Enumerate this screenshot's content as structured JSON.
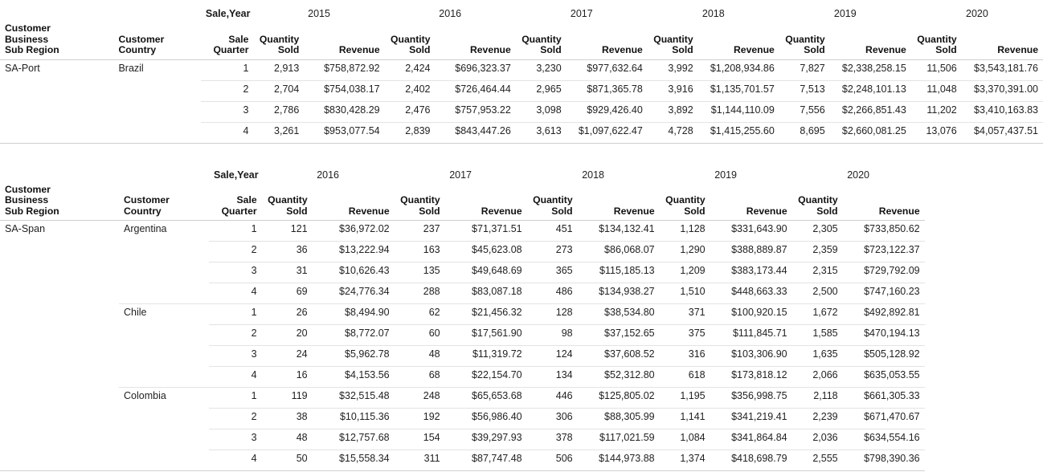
{
  "labels": {
    "sale_year": "Sale,Year",
    "customer_business_sub_region": "Customer\nBusiness\nSub Region",
    "region_line1": "Customer",
    "region_line2": "Business",
    "region_line3": "Sub Region",
    "country_line1": "Customer",
    "country_line2": "Country",
    "quarter_line1": "Sale",
    "quarter_line2": "Quarter",
    "quantity_line1": "Quantity",
    "quantity_line2": "Sold",
    "revenue": "Revenue"
  },
  "tables": [
    {
      "id": "sa-port",
      "years": [
        "2015",
        "2016",
        "2017",
        "2018",
        "2019",
        "2020"
      ],
      "groups": [
        {
          "region": "SA-Port",
          "countries": [
            {
              "country": "Brazil",
              "rows": [
                {
                  "quarter": "1",
                  "cells": [
                    {
                      "qty": "2,913",
                      "rev": "$758,872.92"
                    },
                    {
                      "qty": "2,424",
                      "rev": "$696,323.37"
                    },
                    {
                      "qty": "3,230",
                      "rev": "$977,632.64"
                    },
                    {
                      "qty": "3,992",
                      "rev": "$1,208,934.86"
                    },
                    {
                      "qty": "7,827",
                      "rev": "$2,338,258.15"
                    },
                    {
                      "qty": "11,506",
                      "rev": "$3,543,181.76"
                    }
                  ]
                },
                {
                  "quarter": "2",
                  "cells": [
                    {
                      "qty": "2,704",
                      "rev": "$754,038.17"
                    },
                    {
                      "qty": "2,402",
                      "rev": "$726,464.44"
                    },
                    {
                      "qty": "2,965",
                      "rev": "$871,365.78"
                    },
                    {
                      "qty": "3,916",
                      "rev": "$1,135,701.57"
                    },
                    {
                      "qty": "7,513",
                      "rev": "$2,248,101.13"
                    },
                    {
                      "qty": "11,048",
                      "rev": "$3,370,391.00"
                    }
                  ]
                },
                {
                  "quarter": "3",
                  "cells": [
                    {
                      "qty": "2,786",
                      "rev": "$830,428.29"
                    },
                    {
                      "qty": "2,476",
                      "rev": "$757,953.22"
                    },
                    {
                      "qty": "3,098",
                      "rev": "$929,426.40"
                    },
                    {
                      "qty": "3,892",
                      "rev": "$1,144,110.09"
                    },
                    {
                      "qty": "7,556",
                      "rev": "$2,266,851.43"
                    },
                    {
                      "qty": "11,202",
                      "rev": "$3,410,163.83"
                    }
                  ]
                },
                {
                  "quarter": "4",
                  "cells": [
                    {
                      "qty": "3,261",
                      "rev": "$953,077.54"
                    },
                    {
                      "qty": "2,839",
                      "rev": "$843,447.26"
                    },
                    {
                      "qty": "3,613",
                      "rev": "$1,097,622.47"
                    },
                    {
                      "qty": "4,728",
                      "rev": "$1,415,255.60"
                    },
                    {
                      "qty": "8,695",
                      "rev": "$2,660,081.25"
                    },
                    {
                      "qty": "13,076",
                      "rev": "$4,057,437.51"
                    }
                  ]
                }
              ]
            }
          ]
        }
      ]
    },
    {
      "id": "sa-span",
      "years": [
        "2016",
        "2017",
        "2018",
        "2019",
        "2020"
      ],
      "groups": [
        {
          "region": "SA-Span",
          "countries": [
            {
              "country": "Argentina",
              "rows": [
                {
                  "quarter": "1",
                  "cells": [
                    {
                      "qty": "121",
                      "rev": "$36,972.02"
                    },
                    {
                      "qty": "237",
                      "rev": "$71,371.51"
                    },
                    {
                      "qty": "451",
                      "rev": "$134,132.41"
                    },
                    {
                      "qty": "1,128",
                      "rev": "$331,643.90"
                    },
                    {
                      "qty": "2,305",
                      "rev": "$733,850.62"
                    }
                  ]
                },
                {
                  "quarter": "2",
                  "cells": [
                    {
                      "qty": "36",
                      "rev": "$13,222.94"
                    },
                    {
                      "qty": "163",
                      "rev": "$45,623.08"
                    },
                    {
                      "qty": "273",
                      "rev": "$86,068.07"
                    },
                    {
                      "qty": "1,290",
                      "rev": "$388,889.87"
                    },
                    {
                      "qty": "2,359",
                      "rev": "$723,122.37"
                    }
                  ]
                },
                {
                  "quarter": "3",
                  "cells": [
                    {
                      "qty": "31",
                      "rev": "$10,626.43"
                    },
                    {
                      "qty": "135",
                      "rev": "$49,648.69"
                    },
                    {
                      "qty": "365",
                      "rev": "$115,185.13"
                    },
                    {
                      "qty": "1,209",
                      "rev": "$383,173.44"
                    },
                    {
                      "qty": "2,315",
                      "rev": "$729,792.09"
                    }
                  ]
                },
                {
                  "quarter": "4",
                  "cells": [
                    {
                      "qty": "69",
                      "rev": "$24,776.34"
                    },
                    {
                      "qty": "288",
                      "rev": "$83,087.18"
                    },
                    {
                      "qty": "486",
                      "rev": "$134,938.27"
                    },
                    {
                      "qty": "1,510",
                      "rev": "$448,663.33"
                    },
                    {
                      "qty": "2,500",
                      "rev": "$747,160.23"
                    }
                  ]
                }
              ]
            },
            {
              "country": "Chile",
              "rows": [
                {
                  "quarter": "1",
                  "cells": [
                    {
                      "qty": "26",
                      "rev": "$8,494.90"
                    },
                    {
                      "qty": "62",
                      "rev": "$21,456.32"
                    },
                    {
                      "qty": "128",
                      "rev": "$38,534.80"
                    },
                    {
                      "qty": "371",
                      "rev": "$100,920.15"
                    },
                    {
                      "qty": "1,672",
                      "rev": "$492,892.81"
                    }
                  ]
                },
                {
                  "quarter": "2",
                  "cells": [
                    {
                      "qty": "20",
                      "rev": "$8,772.07"
                    },
                    {
                      "qty": "60",
                      "rev": "$17,561.90"
                    },
                    {
                      "qty": "98",
                      "rev": "$37,152.65"
                    },
                    {
                      "qty": "375",
                      "rev": "$111,845.71"
                    },
                    {
                      "qty": "1,585",
                      "rev": "$470,194.13"
                    }
                  ]
                },
                {
                  "quarter": "3",
                  "cells": [
                    {
                      "qty": "24",
                      "rev": "$5,962.78"
                    },
                    {
                      "qty": "48",
                      "rev": "$11,319.72"
                    },
                    {
                      "qty": "124",
                      "rev": "$37,608.52"
                    },
                    {
                      "qty": "316",
                      "rev": "$103,306.90"
                    },
                    {
                      "qty": "1,635",
                      "rev": "$505,128.92"
                    }
                  ]
                },
                {
                  "quarter": "4",
                  "cells": [
                    {
                      "qty": "16",
                      "rev": "$4,153.56"
                    },
                    {
                      "qty": "68",
                      "rev": "$22,154.70"
                    },
                    {
                      "qty": "134",
                      "rev": "$52,312.80"
                    },
                    {
                      "qty": "618",
                      "rev": "$173,818.12"
                    },
                    {
                      "qty": "2,066",
                      "rev": "$635,053.55"
                    }
                  ]
                }
              ]
            },
            {
              "country": "Colombia",
              "rows": [
                {
                  "quarter": "1",
                  "cells": [
                    {
                      "qty": "119",
                      "rev": "$32,515.48"
                    },
                    {
                      "qty": "248",
                      "rev": "$65,653.68"
                    },
                    {
                      "qty": "446",
                      "rev": "$125,805.02"
                    },
                    {
                      "qty": "1,195",
                      "rev": "$356,998.75"
                    },
                    {
                      "qty": "2,118",
                      "rev": "$661,305.33"
                    }
                  ]
                },
                {
                  "quarter": "2",
                  "cells": [
                    {
                      "qty": "38",
                      "rev": "$10,115.36"
                    },
                    {
                      "qty": "192",
                      "rev": "$56,986.40"
                    },
                    {
                      "qty": "306",
                      "rev": "$88,305.99"
                    },
                    {
                      "qty": "1,141",
                      "rev": "$341,219.41"
                    },
                    {
                      "qty": "2,239",
                      "rev": "$671,470.67"
                    }
                  ]
                },
                {
                  "quarter": "3",
                  "cells": [
                    {
                      "qty": "48",
                      "rev": "$12,757.68"
                    },
                    {
                      "qty": "154",
                      "rev": "$39,297.93"
                    },
                    {
                      "qty": "378",
                      "rev": "$117,021.59"
                    },
                    {
                      "qty": "1,084",
                      "rev": "$341,864.84"
                    },
                    {
                      "qty": "2,036",
                      "rev": "$634,554.16"
                    }
                  ]
                },
                {
                  "quarter": "4",
                  "cells": [
                    {
                      "qty": "50",
                      "rev": "$15,558.34"
                    },
                    {
                      "qty": "311",
                      "rev": "$87,747.48"
                    },
                    {
                      "qty": "506",
                      "rev": "$144,973.88"
                    },
                    {
                      "qty": "1,374",
                      "rev": "$418,698.79"
                    },
                    {
                      "qty": "2,555",
                      "rev": "$798,390.36"
                    }
                  ]
                }
              ]
            }
          ]
        }
      ]
    }
  ]
}
